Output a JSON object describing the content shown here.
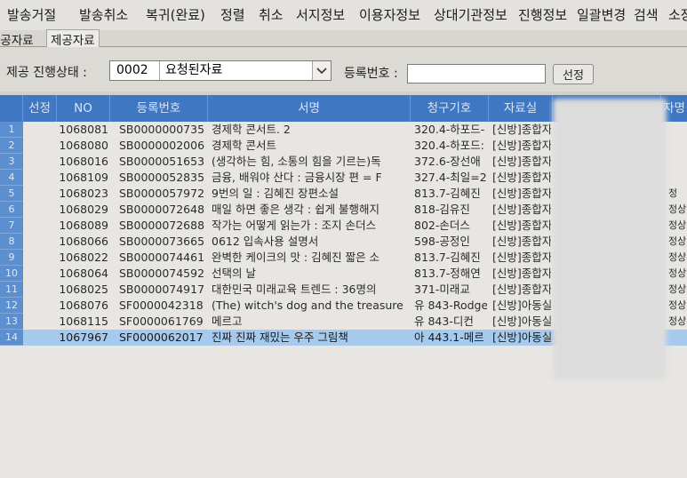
{
  "menu": [
    "발송거절",
    "발송취소",
    "복귀(완료)",
    "정렬",
    "취소",
    "서지정보",
    "이용자정보",
    "상대기관정보",
    "진행정보",
    "일괄변경",
    "검색",
    "소장"
  ],
  "tabs": [
    "제공자료",
    "제공자료"
  ],
  "filter": {
    "status_label": "제공 진행상태 :",
    "status_code": "0002",
    "status_text": "요청된자료",
    "regno_label": "등록번호 :",
    "regno_value": "",
    "select_button": "선정"
  },
  "columns": [
    "선정",
    "NO",
    "등록번호",
    "서명",
    "청구기호",
    "자료실",
    "자명"
  ],
  "rows": [
    {
      "n": "1",
      "no": "1068081",
      "reg": "SB0000000735",
      "title": "경제학 콘서트. 2",
      "call": "320.4-하포드-",
      "room": "[신방]종합자"
    },
    {
      "n": "2",
      "no": "1068080",
      "reg": "SB0000002006",
      "title": "경제학 콘서트",
      "call": "320.4-하포드:",
      "room": "[신방]종합자"
    },
    {
      "n": "3",
      "no": "1068016",
      "reg": "SB0000051653",
      "title": "(생각하는 힘, 소통의 힘을 기르는)독",
      "call": "372.6-장선애",
      "room": "[신방]종합자"
    },
    {
      "n": "4",
      "no": "1068109",
      "reg": "SB0000052835",
      "title": "금융, 배워야 산다 : 금융시장 편 = F",
      "call": "327.4-최일=2",
      "room": "[신방]종합자"
    },
    {
      "n": "5",
      "no": "1068023",
      "reg": "SB0000057972",
      "title": "9번의 일 : 김혜진 장편소설",
      "call": "813.7-김혜진",
      "room": "[신방]종합자"
    },
    {
      "n": "6",
      "no": "1068029",
      "reg": "SB0000072648",
      "title": "매일 하면 좋은 생각 : 쉽게 불행해지",
      "call": "818-김유진",
      "room": "[신방]종합자"
    },
    {
      "n": "7",
      "no": "1068089",
      "reg": "SB0000072688",
      "title": "작가는 어떻게 읽는가 : 조지 손더스",
      "call": "802-손더스",
      "room": "[신방]종합자"
    },
    {
      "n": "8",
      "no": "1068066",
      "reg": "SB0000073665",
      "title": "0612 입속사용 설명서",
      "call": "598-공정인",
      "room": "[신방]종합자"
    },
    {
      "n": "9",
      "no": "1068022",
      "reg": "SB0000074461",
      "title": "완벽한 케이크의 맛 : 김혜진 짧은 소",
      "call": "813.7-김혜진",
      "room": "[신방]종합자"
    },
    {
      "n": "10",
      "no": "1068064",
      "reg": "SB0000074592",
      "title": "선택의 날",
      "call": "813.7-정해연",
      "room": "[신방]종합자"
    },
    {
      "n": "11",
      "no": "1068025",
      "reg": "SB0000074917",
      "title": "대한민국 미래교육 트렌드 : 36명의",
      "call": "371-미래교",
      "room": "[신방]종합자"
    },
    {
      "n": "12",
      "no": "1068076",
      "reg": "SF0000042318",
      "title": "(The) witch's dog and the treasure",
      "call": "유 843-Rodge",
      "room": "[신방]아동실"
    },
    {
      "n": "13",
      "no": "1068115",
      "reg": "SF0000061769",
      "title": "메르고",
      "call": "유 843-디컨",
      "room": "[신방]아동실"
    },
    {
      "n": "14",
      "no": "1067967",
      "reg": "SF0000062017",
      "title": "진짜 진짜 재밌는 우주 그림책",
      "call": "아 443.1-메르",
      "room": "[신방]아동실"
    }
  ],
  "right_col": [
    "정",
    "정상",
    "정상",
    "정상",
    "정상",
    "정상",
    "정상",
    "정상",
    "정상"
  ],
  "colors": {
    "header": "#3f77c2",
    "rownum": "#5b8fd0",
    "selection": "#a6c9ee",
    "grid_bg": "#e8e6e2"
  }
}
